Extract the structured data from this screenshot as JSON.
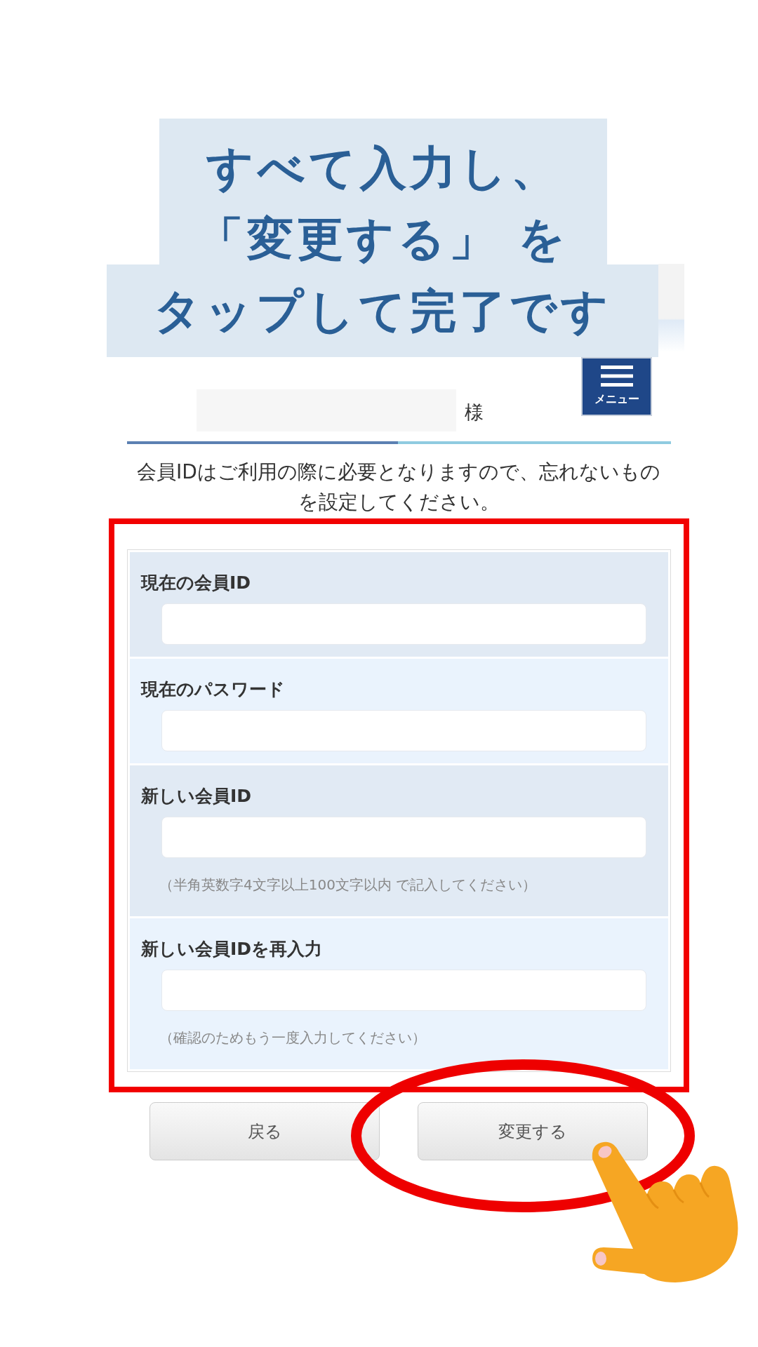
{
  "caption": {
    "blocks": [
      {
        "lines": [
          "すべて入力し、",
          "「変更する」 を"
        ]
      },
      {
        "lines": [
          "タップして完了です"
        ]
      }
    ]
  },
  "header": {
    "name_suffix": "様",
    "menu_button": {
      "label": "メニュー"
    }
  },
  "intro": "会員IDはご利用の際に必要となりますので、忘れないものを設定してください。",
  "form": {
    "framed": true,
    "fields": [
      {
        "label": "現在の会員ID"
      },
      {
        "label": "現在のパスワード"
      },
      {
        "label": "新しい会員ID",
        "note": "（半角英数字4文字以上100文字以内 で記入してください）"
      },
      {
        "label": "新しい会員IDを再入力",
        "note": "（確認のためもう一度入力してください）"
      }
    ]
  },
  "buttons": [
    {
      "label": "戻る",
      "circled": false
    },
    {
      "label": "変更する",
      "circled": true
    }
  ]
}
